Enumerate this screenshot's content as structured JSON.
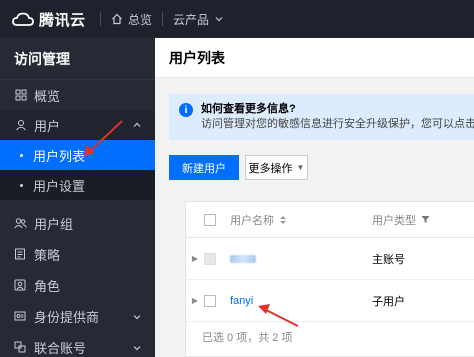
{
  "topbar": {
    "brand": "腾讯云",
    "nav": [
      {
        "label": "总览",
        "icon": "home-icon"
      },
      {
        "label": "云产品",
        "icon": "chevron-down-icon"
      }
    ]
  },
  "sidebar": {
    "title": "访问管理",
    "items": [
      {
        "label": "概览",
        "icon": "grid-icon"
      },
      {
        "label": "用户",
        "icon": "user-icon",
        "expanded": true,
        "children": [
          {
            "label": "用户列表",
            "active": true
          },
          {
            "label": "用户设置"
          }
        ]
      },
      {
        "label": "用户组",
        "icon": "users-icon"
      },
      {
        "label": "策略",
        "icon": "policy-icon"
      },
      {
        "label": "角色",
        "icon": "role-icon"
      },
      {
        "label": "身份提供商",
        "icon": "identity-provider-icon",
        "has_children": true
      },
      {
        "label": "联合账号",
        "icon": "federated-account-icon",
        "has_children": true
      }
    ]
  },
  "main": {
    "title": "用户列表",
    "info": {
      "title": "如何查看更多信息?",
      "desc": "访问管理对您的敏感信息进行安全升级保护，您可以点击列表中左"
    },
    "toolbar": {
      "create_label": "新建用户",
      "more_label": "更多操作"
    },
    "table": {
      "columns": [
        "用户名称",
        "用户类型"
      ],
      "rows": [
        {
          "name": "",
          "type": "主账号",
          "name_blurred": true
        },
        {
          "name": "fanyi",
          "type": "子用户"
        }
      ],
      "footer": "已选 0 项，共 2 项"
    }
  },
  "colors": {
    "accent": "#006eff",
    "topbar_bg": "#1e222d",
    "sidebar_bg": "#262a35",
    "annotation_arrow": "#e0312b"
  }
}
